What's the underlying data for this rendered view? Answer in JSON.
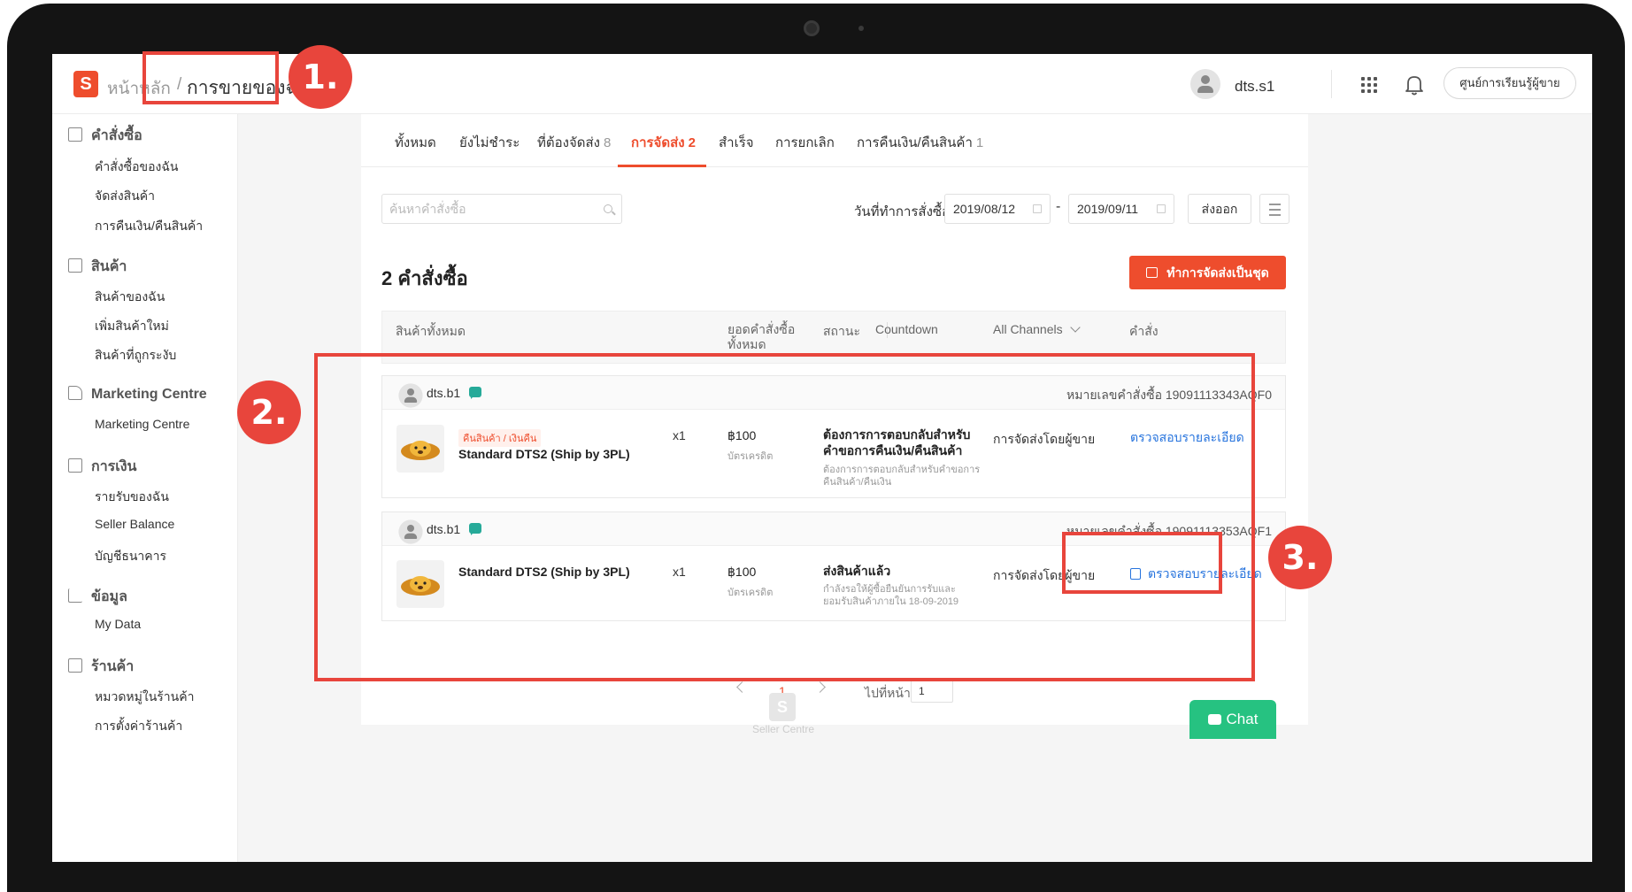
{
  "header": {
    "breadcrumb_home": "หน้าหลัก",
    "breadcrumb_separator": "/",
    "breadcrumb_current": "การขายของฉัน",
    "user_name": "dts.s1",
    "learning_center": "ศูนย์การเรียนรู้ผู้ขาย"
  },
  "sidebar": {
    "groups": [
      {
        "title": "คำสั่งซื้อ",
        "icon": "order-icon",
        "items": [
          "คำสั่งซื้อของฉัน",
          "จัดส่งสินค้า",
          "การคืนเงิน/คืนสินค้า"
        ]
      },
      {
        "title": "สินค้า",
        "icon": "product-icon",
        "items": [
          "สินค้าของฉัน",
          "เพิ่มสินค้าใหม่",
          "สินค้าที่ถูกระงับ"
        ]
      },
      {
        "title": "Marketing Centre",
        "icon": "tag-icon",
        "items": [
          "Marketing Centre"
        ]
      },
      {
        "title": "การเงิน",
        "icon": "wallet-icon",
        "items": [
          "รายรับของฉัน",
          "Seller Balance",
          "บัญชีธนาคาร"
        ]
      },
      {
        "title": "ข้อมูล",
        "icon": "chart-icon",
        "items": [
          "My Data"
        ]
      },
      {
        "title": "ร้านค้า",
        "icon": "shop-icon",
        "items": [
          "หมวดหมู่ในร้านค้า",
          "การตั้งค่าร้านค้า"
        ]
      }
    ]
  },
  "tabs": [
    {
      "label": "ทั้งหมด",
      "count": ""
    },
    {
      "label": "ยังไม่ชำระ",
      "count": ""
    },
    {
      "label": "ที่ต้องจัดส่ง",
      "count": "8"
    },
    {
      "label": "การจัดส่ง",
      "count": "2"
    },
    {
      "label": "สำเร็จ",
      "count": ""
    },
    {
      "label": "การยกเลิก",
      "count": ""
    },
    {
      "label": "การคืนเงิน/คืนสินค้า",
      "count": "1"
    }
  ],
  "filters": {
    "search_placeholder": "ค้นหาคำสั่งซื้อ",
    "date_label": "วันที่ทำการสั่งซื้อ",
    "date_from": "2019/08/12",
    "date_sep": "-",
    "date_to": "2019/09/11",
    "export_label": "ส่งออก"
  },
  "summary": {
    "order_count_title": "2 คำสั่งซื้อ",
    "batch_ship_label": "ทำการจัดส่งเป็นชุด"
  },
  "table_header": {
    "products": "สินค้าทั้งหมด",
    "total_line1": "ยอดคำสั่งซื้อ",
    "total_line2": "ทั้งหมด",
    "status": "สถานะ",
    "countdown": "Countdown",
    "channels": "All Channels",
    "action": "คำสั่ง"
  },
  "orders": [
    {
      "buyer": "dts.b1",
      "order_no": "หมายเลขคำสั่งซื้อ 19091113343AQF0",
      "tag": "คืนสินค้า / เงินคืน",
      "product": "Standard DTS2 (Ship by 3PL)",
      "qty": "x1",
      "price": "฿100",
      "payment": "บัตรเครดิต",
      "status_line1": "ต้องการการตอบกลับสำหรับ",
      "status_line2": "คำขอการคืนเงิน/คืนสินค้า",
      "status_sub_line1": "ต้องการการตอบกลับสำหรับคำขอการ",
      "status_sub_line2": "คืนสินค้า/คืนเงิน",
      "channel": "การจัดส่งโดยผู้ขาย",
      "action": "ตรวจสอบรายละเอียด"
    },
    {
      "buyer": "dts.b1",
      "order_no": "หมายเลขคำสั่งซื้อ 19091113353AQF1",
      "tag": "",
      "product": "Standard DTS2 (Ship by 3PL)",
      "qty": "x1",
      "price": "฿100",
      "payment": "บัตรเครดิต",
      "status_line1": "ส่งสินค้าแล้ว",
      "status_line2": "",
      "status_sub_line1": "กำลังรอให้ผู้ซื้อยืนยันการรับและ",
      "status_sub_line2": "ยอมรับสินค้าภายใน 18-09-2019",
      "channel": "การจัดส่งโดยผู้ขาย",
      "action": "ตรวจสอบรายละเอียด"
    }
  ],
  "pagination": {
    "current": "1",
    "goto_label": "ไปที่หน้า",
    "goto_value": "1"
  },
  "footer": {
    "seller_centre_logo": "S",
    "seller_centre": "Seller Centre",
    "chat": "Chat"
  },
  "annotations": [
    "1.",
    "2.",
    "3."
  ],
  "colors": {
    "brand": "#ee4d2d",
    "link": "#2673dd",
    "chat": "#26c281",
    "annotation": "#e8453c"
  }
}
